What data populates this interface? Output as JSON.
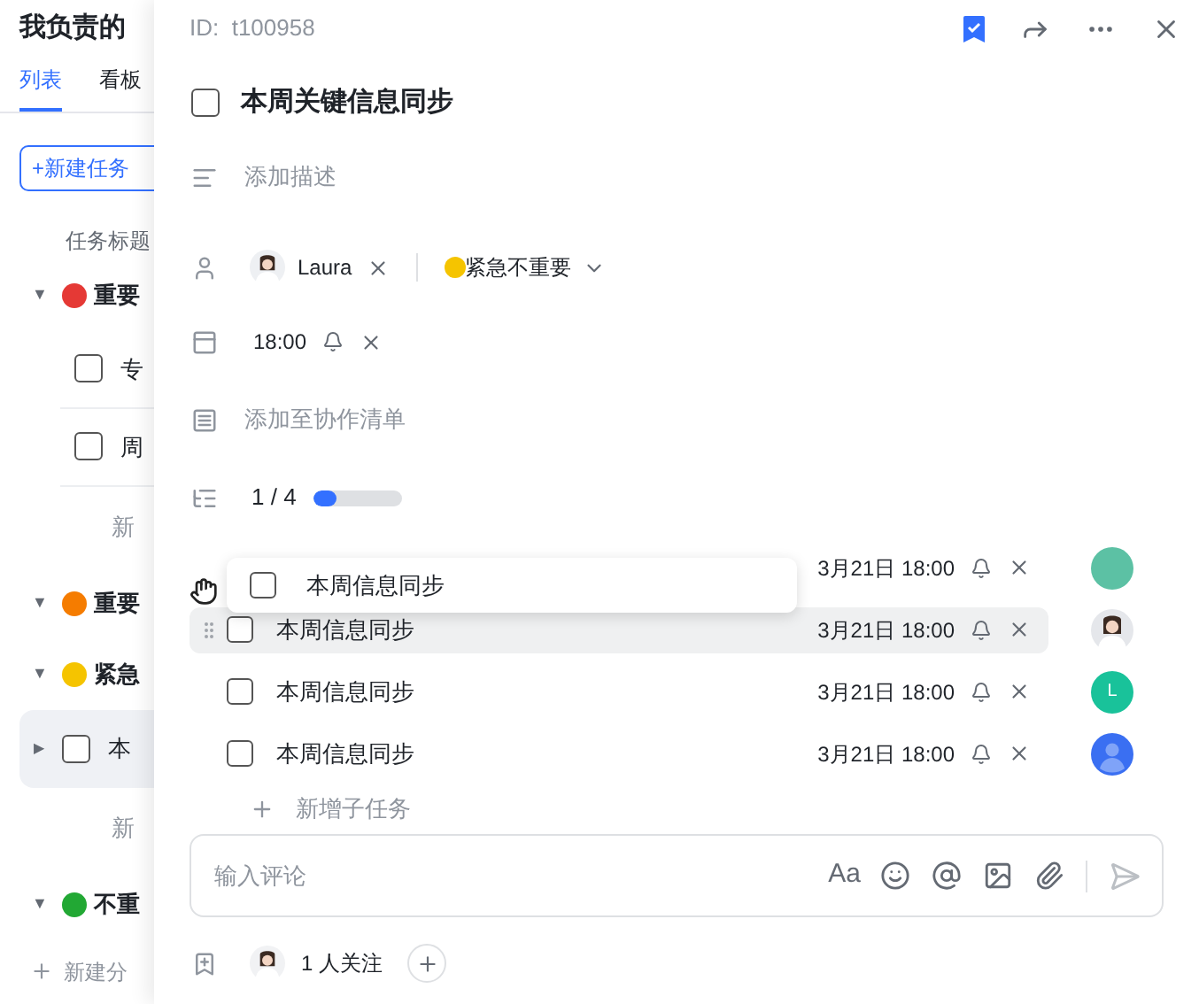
{
  "sidebar": {
    "title": "我负责的",
    "tabs": [
      {
        "label": "列表",
        "selected": true
      },
      {
        "label": "看板",
        "selected": false
      }
    ],
    "new_task_button": "+新建任务",
    "column_header": "任务标题",
    "groups": [
      {
        "caret": "▼",
        "label": "重要",
        "color": "#e53935",
        "expanded": true,
        "tasks": [
          {
            "title": "专",
            "selected": false,
            "checked": false
          },
          {
            "title": "周",
            "selected": false,
            "checked": false
          }
        ],
        "new_item": "新"
      },
      {
        "caret": "▼",
        "label": "重要",
        "color": "#f57c00",
        "expanded": true
      },
      {
        "caret": "▼",
        "label": "紧急",
        "color": "#f5c400",
        "expanded": true,
        "tasks": [
          {
            "caret": "▶",
            "title": "本",
            "selected": true,
            "checked": false
          }
        ],
        "new_item": "新"
      },
      {
        "caret": "▼",
        "label": "不重",
        "color": "#22a834",
        "expanded": true
      }
    ],
    "new_group": "新建分"
  },
  "detail": {
    "id": "ID:  t100958",
    "title": "本周关键信息同步",
    "checked": false,
    "following": true,
    "description_placeholder": "添加描述",
    "assignee": {
      "name": "Laura"
    },
    "priority": {
      "label": "紧急不重要",
      "color": "#f5c400"
    },
    "due": "18:00",
    "list_placeholder": "添加至协作清单",
    "progress": {
      "text": "1 / 4",
      "level": 0.25
    },
    "subtasks": [
      {
        "due": "3月21日 18:00",
        "dragging": false,
        "avatar": {
          "kind": "blank",
          "color": "#5cc1a4"
        }
      },
      {
        "title": "本周信息同步",
        "due": "3月21日 18:00",
        "checked": false,
        "dragging": true,
        "avatar": {
          "kind": "person",
          "color": "#e5e7eb"
        }
      },
      {
        "title": "本周信息同步",
        "due": "3月21日 18:00",
        "checked": false,
        "dragging": false,
        "avatar": {
          "kind": "letter",
          "letter": "L",
          "color": "#19c29a"
        }
      },
      {
        "title": "本周信息同步",
        "due": "3月21日 18:00",
        "checked": false,
        "dragging": false,
        "avatar": {
          "kind": "silhouette",
          "color": "#3a6ff2"
        }
      }
    ],
    "dragged_item": {
      "title": "本周信息同步",
      "checked": false
    },
    "add_subtask": "新增子任务",
    "comment_placeholder": "输入评论",
    "format_button": "Aa",
    "followers": "1 人关注"
  }
}
